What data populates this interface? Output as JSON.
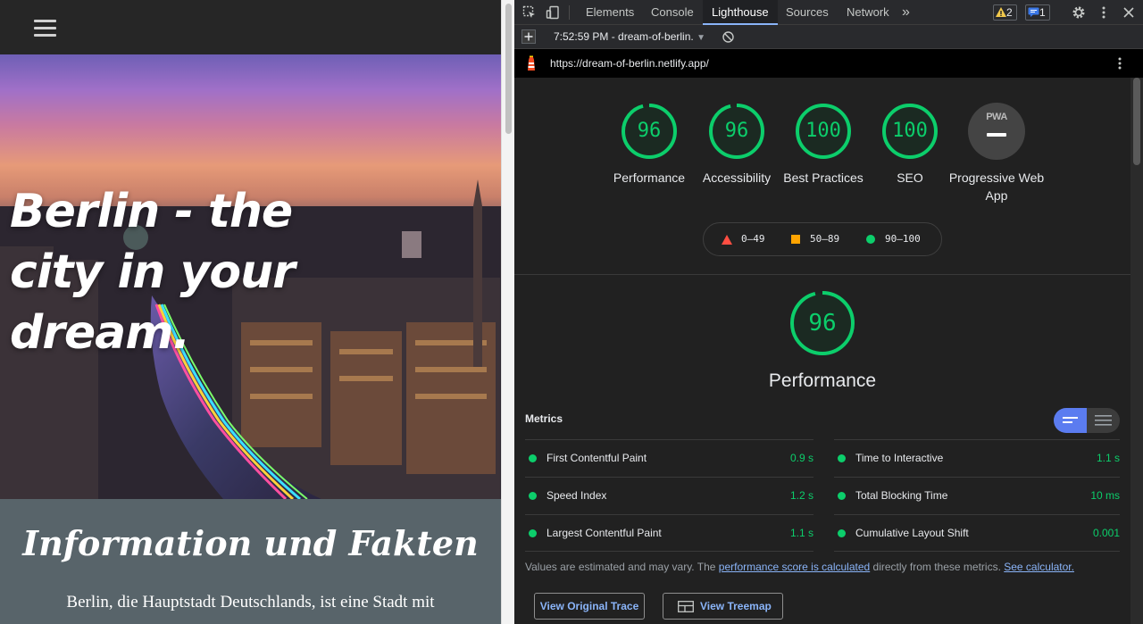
{
  "page": {
    "hero_title": "Berlin - the city in your dream.",
    "info_title": "Information und Fakten",
    "info_text": "Berlin, die Hauptstadt Deutschlands, ist eine Stadt mit"
  },
  "devtools": {
    "tabs": [
      {
        "label": "Elements"
      },
      {
        "label": "Console"
      },
      {
        "label": "Lighthouse"
      },
      {
        "label": "Sources"
      },
      {
        "label": "Network"
      }
    ],
    "more_tabs": "»",
    "warnings_count": "2",
    "messages_count": "1",
    "run_title": "7:52:59 PM - dream-of-berlin.",
    "url": "https://dream-of-berlin.netlify.app/"
  },
  "scores": [
    {
      "label": "Performance",
      "value": "96"
    },
    {
      "label": "Accessibility",
      "value": "96"
    },
    {
      "label": "Best Practices",
      "value": "100"
    },
    {
      "label": "SEO",
      "value": "100"
    },
    {
      "label": "Progressive Web App",
      "value": "PWA"
    }
  ],
  "legend": {
    "fail": "0–49",
    "average": "50–89",
    "pass": "90–100"
  },
  "performance": {
    "score": "96",
    "label": "Performance"
  },
  "metrics": {
    "heading": "Metrics",
    "items": [
      {
        "name": "First Contentful Paint",
        "value": "0.9 s"
      },
      {
        "name": "Time to Interactive",
        "value": "1.1 s"
      },
      {
        "name": "Speed Index",
        "value": "1.2 s"
      },
      {
        "name": "Total Blocking Time",
        "value": "10 ms"
      },
      {
        "name": "Largest Contentful Paint",
        "value": "1.1 s"
      },
      {
        "name": "Cumulative Layout Shift",
        "value": "0.001"
      }
    ],
    "note_prefix": "Values are estimated and may vary. The ",
    "note_link": "performance score is calculated",
    "note_mid": " directly from these metrics. ",
    "note_link2": "See calculator."
  },
  "buttons": {
    "trace": "View Original Trace",
    "treemap": "View Treemap"
  },
  "colors": {
    "pass": "#0cce6b",
    "average": "#ffa400",
    "fail": "#ff4e42",
    "accent": "#8ab4f8"
  }
}
